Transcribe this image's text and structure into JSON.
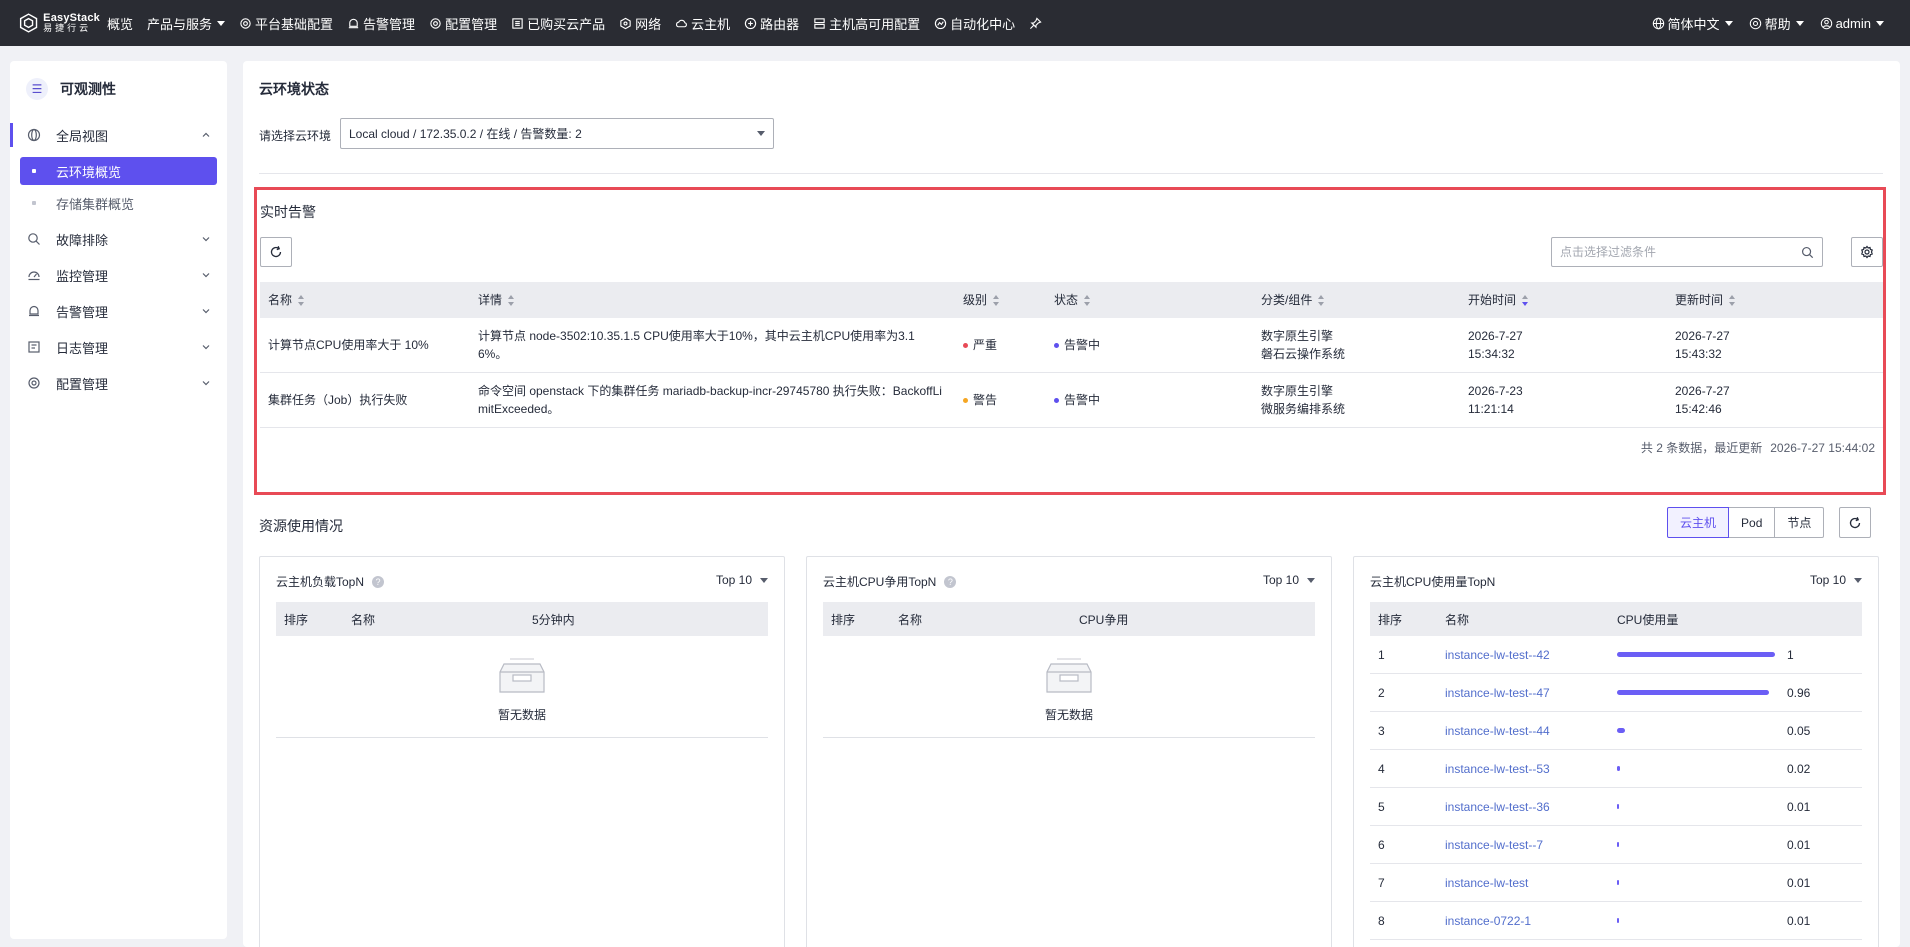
{
  "topbar": {
    "brand_en": "EasyStack",
    "brand_cn": "易捷行云",
    "nav": [
      {
        "label": "概览",
        "icon": "",
        "caret": false
      },
      {
        "label": "产品与服务",
        "icon": "",
        "caret": true
      },
      {
        "label": "平台基础配置",
        "icon": "gear-icon",
        "caret": false
      },
      {
        "label": "告警管理",
        "icon": "bell-icon",
        "caret": false
      },
      {
        "label": "配置管理",
        "icon": "gear-icon",
        "caret": false
      },
      {
        "label": "已购买云产品",
        "icon": "list-icon",
        "caret": false
      },
      {
        "label": "网络",
        "icon": "network-icon",
        "caret": false
      },
      {
        "label": "云主机",
        "icon": "cloud-icon",
        "caret": false
      },
      {
        "label": "路由器",
        "icon": "router-icon",
        "caret": false
      },
      {
        "label": "主机高可用配置",
        "icon": "server-icon",
        "caret": false
      },
      {
        "label": "自动化中心",
        "icon": "automation-icon",
        "caret": false
      },
      {
        "label": "",
        "icon": "pin-icon",
        "caret": false
      }
    ],
    "language": "简体中文",
    "help": "帮助",
    "user": "admin"
  },
  "sidebar": {
    "title": "可观测性",
    "groups": [
      {
        "label": "全局视图",
        "icon": "globe-icon",
        "expanded": true
      },
      {
        "label": "故障排除",
        "icon": "search-icon",
        "expanded": false
      },
      {
        "label": "监控管理",
        "icon": "monitor-icon",
        "expanded": false
      },
      {
        "label": "告警管理",
        "icon": "bell-icon",
        "expanded": false
      },
      {
        "label": "日志管理",
        "icon": "log-icon",
        "expanded": false
      },
      {
        "label": "配置管理",
        "icon": "gear-icon",
        "expanded": false
      }
    ],
    "subitems": [
      {
        "label": "云环境概览",
        "active": true
      },
      {
        "label": "存储集群概览",
        "active": false
      }
    ]
  },
  "env": {
    "title": "云环境状态",
    "select_label": "请选择云环境",
    "select_value": "Local cloud / 172.35.0.2 / 在线 / 告警数量: 2"
  },
  "alerts": {
    "title": "实时告警",
    "filter_placeholder": "点击选择过滤条件",
    "columns": [
      "名称",
      "详情",
      "级别",
      "状态",
      "分类/组件",
      "开始时间",
      "更新时间"
    ],
    "rows": [
      {
        "name": "计算节点CPU使用率大于 10%",
        "detail": "计算节点 node-3502:10.35.1.5 CPU使用率大于10%，其中云主机CPU使用率为3.16%。",
        "level": "严重",
        "level_color": "#e84a56",
        "status": "告警中",
        "status_color": "#5e50ee",
        "category_1": "数字原生引擎",
        "category_2": "磐石云操作系统",
        "start_date": "2026-7-27",
        "start_time": "15:34:32",
        "update_date": "2026-7-27",
        "update_time": "15:43:32"
      },
      {
        "name": "集群任务（Job）执行失败",
        "detail": "命令空间 openstack 下的集群任务 mariadb-backup-incr-29745780 执行失败：BackoffLimitExceeded。",
        "level": "警告",
        "level_color": "#f5a623",
        "status": "告警中",
        "status_color": "#5e50ee",
        "category_1": "数字原生引擎",
        "category_2": "微服务编排系统",
        "start_date": "2026-7-23",
        "start_time": "11:21:14",
        "update_date": "2026-7-27",
        "update_time": "15:42:46"
      }
    ],
    "footer_count": "共 2 条数据，最近更新",
    "footer_time": "2026-7-27 15:44:02"
  },
  "resources": {
    "title": "资源使用情况",
    "tabs": [
      "云主机",
      "Pod",
      "节点"
    ],
    "active_tab": "云主机",
    "cards": [
      {
        "title": "云主机负载TopN",
        "topn": "Top 10",
        "columns": [
          "排序",
          "名称",
          "5分钟内"
        ],
        "empty": "暂无数据"
      },
      {
        "title": "云主机CPU争用TopN",
        "topn": "Top 10",
        "columns": [
          "排序",
          "名称",
          "CPU争用"
        ],
        "empty": "暂无数据"
      },
      {
        "title": "云主机CPU使用量TopN",
        "topn": "Top 10",
        "columns": [
          "排序",
          "名称",
          "CPU使用量"
        ]
      }
    ],
    "cpu_usage": [
      {
        "rank": "1",
        "name": "instance-lw-test--42",
        "value": "1",
        "fraction": 1.0
      },
      {
        "rank": "2",
        "name": "instance-lw-test--47",
        "value": "0.96",
        "fraction": 0.96
      },
      {
        "rank": "3",
        "name": "instance-lw-test--44",
        "value": "0.05",
        "fraction": 0.05
      },
      {
        "rank": "4",
        "name": "instance-lw-test--53",
        "value": "0.02",
        "fraction": 0.02
      },
      {
        "rank": "5",
        "name": "instance-lw-test--36",
        "value": "0.01",
        "fraction": 0.01
      },
      {
        "rank": "6",
        "name": "instance-lw-test--7",
        "value": "0.01",
        "fraction": 0.01
      },
      {
        "rank": "7",
        "name": "instance-lw-test",
        "value": "0.01",
        "fraction": 0.01
      },
      {
        "rank": "8",
        "name": "instance-0722-1",
        "value": "0.01",
        "fraction": 0.01
      }
    ]
  }
}
